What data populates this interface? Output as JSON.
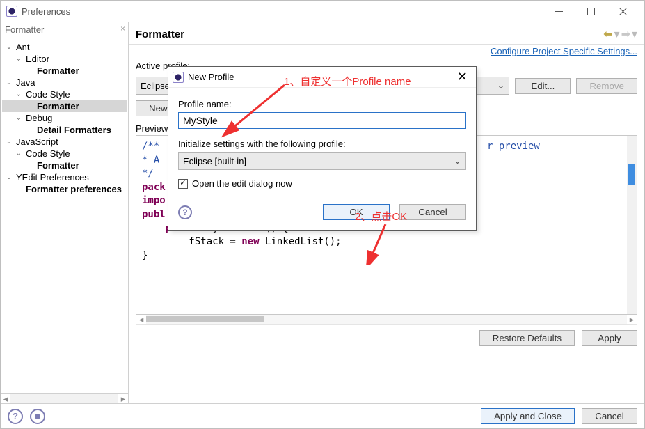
{
  "window": {
    "title": "Preferences"
  },
  "filter": {
    "value": "Formatter",
    "clear_label": "×"
  },
  "tree": [
    {
      "label": "Ant",
      "depth": 0,
      "expanded": true
    },
    {
      "label": "Editor",
      "depth": 1,
      "expanded": true
    },
    {
      "label": "Formatter",
      "depth": 2,
      "bold": true
    },
    {
      "label": "Java",
      "depth": 0,
      "expanded": true
    },
    {
      "label": "Code Style",
      "depth": 1,
      "expanded": true
    },
    {
      "label": "Formatter",
      "depth": 2,
      "bold": true,
      "selected": true
    },
    {
      "label": "Debug",
      "depth": 1,
      "expanded": true
    },
    {
      "label": "Detail Formatters",
      "depth": 2,
      "bold": true
    },
    {
      "label": "JavaScript",
      "depth": 0,
      "expanded": true
    },
    {
      "label": "Code Style",
      "depth": 1,
      "expanded": true
    },
    {
      "label": "Formatter",
      "depth": 2,
      "bold": true
    },
    {
      "label": "YEdit Preferences",
      "depth": 0,
      "expanded": true
    },
    {
      "label": "Formatter preferences",
      "depth": 1,
      "bold": true
    }
  ],
  "right": {
    "title": "Formatter",
    "project_link": "Configure Project Specific Settings...",
    "active_profile_label": "Active profile:",
    "active_profile_value": "Eclipse [built-in]",
    "edit_btn": "Edit...",
    "remove_btn": "Remove",
    "new_btn": "New...",
    "preview_label": "Preview:",
    "restore_btn": "Restore Defaults",
    "apply_btn": "Apply",
    "preview_right_text": "r preview"
  },
  "code_lines": [
    {
      "cls": "cm",
      "text": "/**"
    },
    {
      "cls": "cm",
      "text": " * A"
    },
    {
      "cls": "cm",
      "text": " */"
    },
    {
      "cls": "",
      "text": ""
    },
    {
      "raw": "<span class='kw'>pack</span>"
    },
    {
      "raw": "<span class='kw'>impo</span>"
    },
    {
      "raw": "<span class='kw'>publ</span>"
    },
    {
      "cls": "",
      "text": ""
    },
    {
      "raw": "&nbsp;&nbsp;&nbsp;&nbsp;<span class='kw'>public</span> MyIntStack() {"
    },
    {
      "cls": "",
      "text": "        fStack = ",
      "raw": "&nbsp;&nbsp;&nbsp;&nbsp;&nbsp;&nbsp;&nbsp;&nbsp;fStack = <span class='kw'>new</span> LinkedList();"
    },
    {
      "cls": "",
      "text": "    }"
    }
  ],
  "bottom": {
    "apply_close": "Apply and Close",
    "cancel": "Cancel"
  },
  "modal": {
    "title": "New Profile",
    "name_label": "Profile name:",
    "name_value": "MyStyle",
    "init_label": "Initialize settings with the following profile:",
    "init_value": "Eclipse [built-in]",
    "open_edit_label": "Open the edit dialog now",
    "open_edit_checked": true,
    "ok": "OK",
    "cancel": "Cancel"
  },
  "annotations": {
    "a1": "1、自定义一个Profile name",
    "a2": "2、点击OK"
  }
}
